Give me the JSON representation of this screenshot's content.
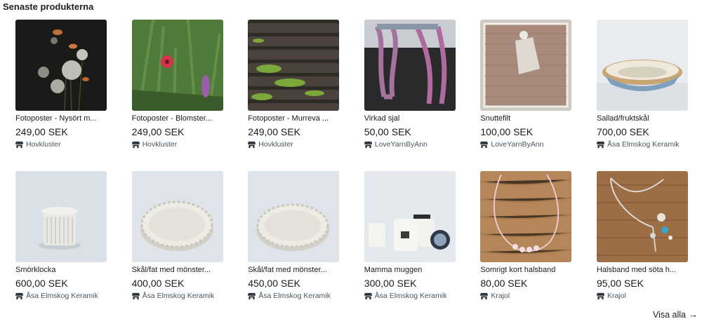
{
  "section": {
    "title": "Senaste produkterna",
    "view_all_label": "Visa alla",
    "view_all_arrow": "→"
  },
  "products": [
    {
      "title": "Fotoposter - Nysört m...",
      "price": "249,00 SEK",
      "seller": "Hovkluster"
    },
    {
      "title": "Fotoposter - Blomster...",
      "price": "249,00 SEK",
      "seller": "Hovkluster"
    },
    {
      "title": "Fotoposter - Murreva ...",
      "price": "249,00 SEK",
      "seller": "Hovkluster"
    },
    {
      "title": "Virkad sjal",
      "price": "50,00 SEK",
      "seller": "LoveYarnByAnn"
    },
    {
      "title": "Snuttefilt",
      "price": "100,00 SEK",
      "seller": "LoveYarnByAnn"
    },
    {
      "title": "Sallad/fruktskål",
      "price": "700,00 SEK",
      "seller": "Åsa Elmskog Keramik"
    },
    {
      "title": "Smörklocka",
      "price": "600,00 SEK",
      "seller": "Åsa Elmskog Keramik"
    },
    {
      "title": "Skål/fat med mönster...",
      "price": "400,00 SEK",
      "seller": "Åsa Elmskog Keramik"
    },
    {
      "title": "Skål/fat med mönster...",
      "price": "450,00 SEK",
      "seller": "Åsa Elmskog Keramik"
    },
    {
      "title": "Mamma muggen",
      "price": "300,00 SEK",
      "seller": "Åsa Elmskog Keramik"
    },
    {
      "title": "Somrigt kort halsband",
      "price": "80,00 SEK",
      "seller": "Krajol"
    },
    {
      "title": "Halsband med söta h...",
      "price": "95,00 SEK",
      "seller": "Krajol"
    }
  ]
}
